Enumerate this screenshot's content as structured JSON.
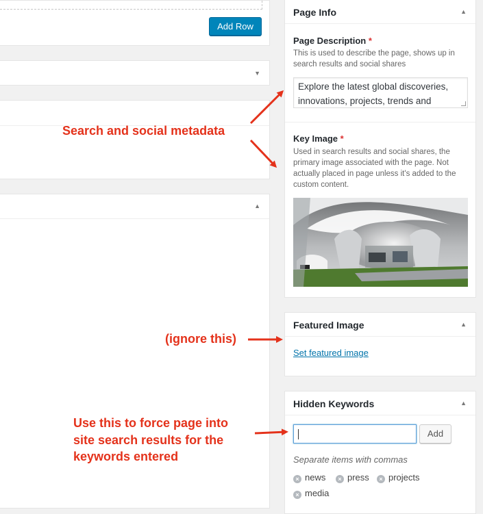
{
  "left_panels": {
    "add_row_label": "Add Row"
  },
  "page_info": {
    "title": "Page Info",
    "description_label": "Page Description",
    "description_help": "This is used to describe the page, shows up in search results and social shares",
    "description_value": "Explore the latest global discoveries, innovations, projects, trends and",
    "key_image_label": "Key Image",
    "key_image_help": "Used in search results and social shares, the primary image associated with the page. Not actually placed in page unless it's added to the custom content.",
    "required_mark": "*"
  },
  "featured_image": {
    "title": "Featured Image",
    "link": "Set featured image"
  },
  "hidden_keywords": {
    "title": "Hidden Keywords",
    "input_value": "",
    "add_label": "Add",
    "hint": "Separate items with commas",
    "tags": [
      "news",
      "press",
      "projects",
      "media"
    ],
    "remove_glyph": "×"
  },
  "annotations": {
    "metadata": "Search and social metadata",
    "ignore": "(ignore this)",
    "keywords_1": "Use this to force page into",
    "keywords_2": "site search results for the",
    "keywords_3": "keywords entered"
  },
  "colors": {
    "annotation": "#e4321b",
    "primary_button": "#0085ba",
    "link": "#0073aa"
  },
  "icons": {
    "collapse": "arrow-up-icon",
    "expand": "arrow-down-icon"
  }
}
